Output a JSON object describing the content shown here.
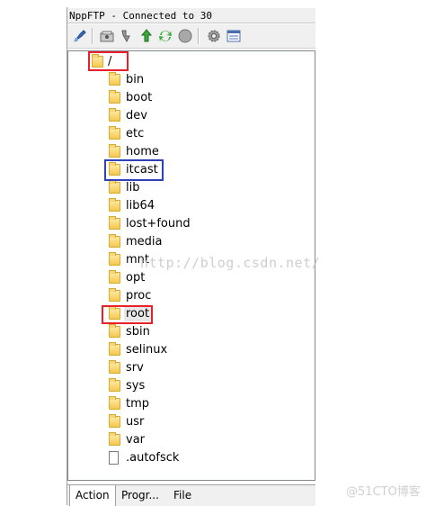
{
  "window": {
    "title": "NppFTP - Connected to 30"
  },
  "toolbar": {
    "buttons": [
      {
        "icon": "connect-icon"
      },
      {
        "icon": "open-folder-icon"
      },
      {
        "icon": "download-icon"
      },
      {
        "icon": "upload-icon"
      },
      {
        "icon": "refresh-icon"
      },
      {
        "icon": "abort-icon"
      },
      {
        "icon": "settings-icon"
      },
      {
        "icon": "message-window-icon"
      }
    ]
  },
  "tree": {
    "root": "/",
    "items": [
      {
        "name": "bin",
        "type": "folder"
      },
      {
        "name": "boot",
        "type": "folder"
      },
      {
        "name": "dev",
        "type": "folder"
      },
      {
        "name": "etc",
        "type": "folder"
      },
      {
        "name": "home",
        "type": "folder"
      },
      {
        "name": "itcast",
        "type": "folder"
      },
      {
        "name": "lib",
        "type": "folder"
      },
      {
        "name": "lib64",
        "type": "folder"
      },
      {
        "name": "lost+found",
        "type": "folder"
      },
      {
        "name": "media",
        "type": "folder"
      },
      {
        "name": "mnt",
        "type": "folder"
      },
      {
        "name": "opt",
        "type": "folder"
      },
      {
        "name": "proc",
        "type": "folder"
      },
      {
        "name": "root",
        "type": "folder"
      },
      {
        "name": "sbin",
        "type": "folder"
      },
      {
        "name": "selinux",
        "type": "folder"
      },
      {
        "name": "srv",
        "type": "folder"
      },
      {
        "name": "sys",
        "type": "folder"
      },
      {
        "name": "tmp",
        "type": "folder"
      },
      {
        "name": "usr",
        "type": "folder"
      },
      {
        "name": "var",
        "type": "folder"
      },
      {
        "name": ".autofsck",
        "type": "file"
      }
    ]
  },
  "tabs": [
    {
      "label": "Action"
    },
    {
      "label": "Progr..."
    },
    {
      "label": "File"
    }
  ],
  "watermark": "http://blog.csdn.net/",
  "brand": "@51CTO博客",
  "colors": {
    "highlight_red": "#e8202a",
    "highlight_blue": "#3040b8",
    "folder": "#f5c94f"
  }
}
